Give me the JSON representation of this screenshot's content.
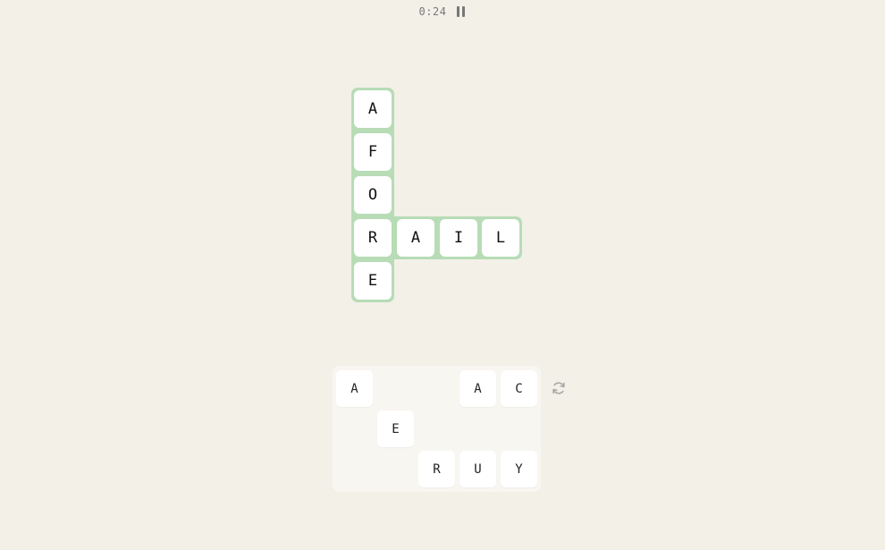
{
  "timer": {
    "value": "0:24"
  },
  "board": {
    "down_word": [
      "A",
      "F",
      "O",
      "R",
      "E"
    ],
    "across_word": [
      "R",
      "A",
      "I",
      "L"
    ],
    "highlight_color": "#b7dcb6"
  },
  "rack": {
    "row1": [
      "A",
      "A",
      "C"
    ],
    "row2": [
      "E"
    ],
    "row3": [
      "R",
      "U",
      "Y"
    ]
  },
  "icons": {
    "pause": "pause-icon",
    "shuffle": "shuffle-icon"
  }
}
